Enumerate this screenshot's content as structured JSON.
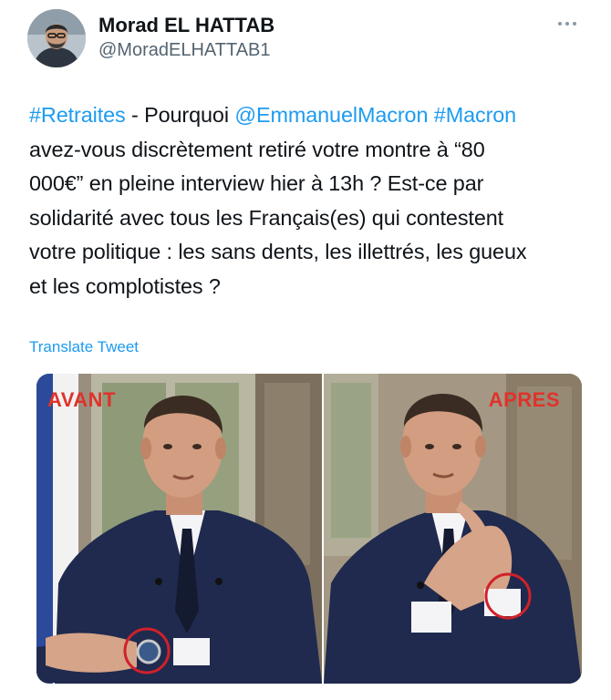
{
  "author": {
    "display_name": "Morad EL HATTAB",
    "handle": "@MoradELHATTAB1"
  },
  "icons": {
    "more": "more-horizontal-icon",
    "avatar": "avatar"
  },
  "tweet": {
    "lines": [
      [
        {
          "text": "#Retraites",
          "type": "hashtag"
        },
        {
          "text": " - Pourquoi ",
          "type": "text"
        },
        {
          "text": "@EmmanuelMacron",
          "type": "mention"
        },
        {
          "text": " ",
          "type": "text"
        },
        {
          "text": "#Macron",
          "type": "hashtag"
        }
      ],
      [
        {
          "text": "avez-vous discrètement retiré votre montre à “80",
          "type": "text"
        }
      ],
      [
        {
          "text": "000€” en pleine interview hier à 13h ? Est-ce par",
          "type": "text"
        }
      ],
      [
        {
          "text": "solidarité avec tous les Français(es) qui contestent",
          "type": "text"
        }
      ],
      [
        {
          "text": "votre politique : les sans dents, les illettrés, les gueux",
          "type": "text"
        }
      ],
      [
        {
          "text": "et les complotistes ?",
          "type": "text"
        }
      ]
    ]
  },
  "translate_label": "Translate Tweet",
  "media": {
    "left_label": "AVANT",
    "right_label": "APRES"
  },
  "colors": {
    "link": "#1d9bf0",
    "secondary_text": "#536471",
    "label_red": "#e0322b",
    "circle_red": "#d1202a"
  }
}
